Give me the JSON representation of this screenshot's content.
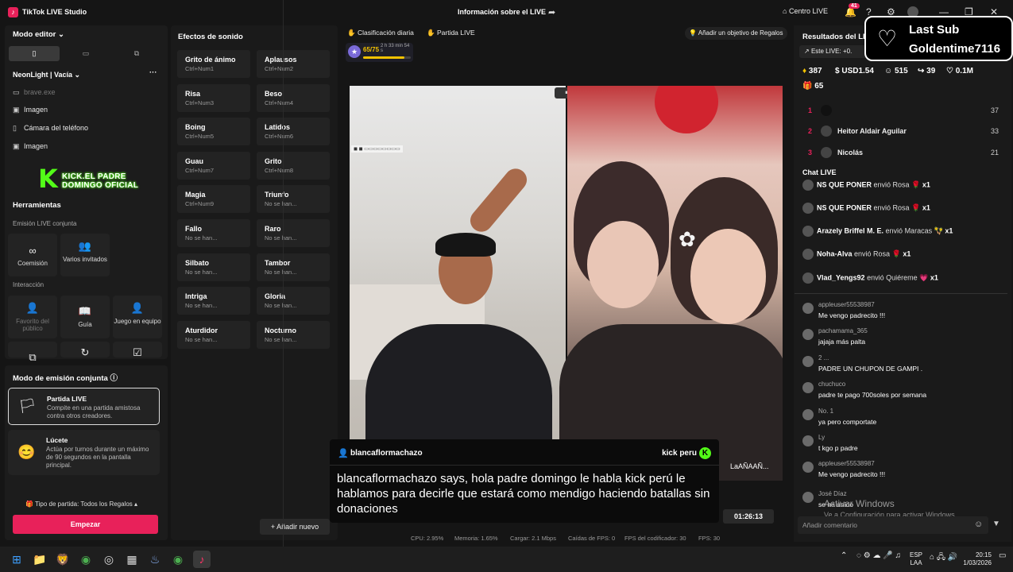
{
  "app": {
    "title": "TikTok LIVE Studio",
    "center_title": "Información sobre el LIVE",
    "home_label": "Centro LIVE",
    "notif_count": "41"
  },
  "left": {
    "editor_mode": "Modo editor",
    "scene_name": "NeonLight | Vacía",
    "sources": [
      {
        "label": "brave.exe",
        "icon": "window-icon"
      },
      {
        "label": "Imagen",
        "icon": "image-icon"
      },
      {
        "label": "Cámara del teléfono",
        "icon": "phone-icon"
      },
      {
        "label": "Imagen",
        "icon": "image-icon"
      }
    ],
    "kick_banner": "KICK.EL PADRE DOMINGO OFICIAL",
    "tools_title": "Herramientas",
    "joint_emit": "Emisión LIVE conjunta",
    "coemission": "Coemisión",
    "multi_guests": "Varios invitados",
    "interaction": "Interacción",
    "fav_public": "Favorito del público",
    "guide": "Guía",
    "team_game": "Juego en equipo"
  },
  "joint": {
    "title": "Modo de emisión conjunta",
    "cards": [
      {
        "title": "Partida LIVE",
        "desc": "Compite en una partida amistosa contra otros creadores."
      },
      {
        "title": "Lúcete",
        "desc": "Actúa por turnos durante un máximo de 90 segundos en la pantalla principal."
      }
    ],
    "match_type": "Tipo de partida: Todos los Regalos",
    "start": "Empezar"
  },
  "sounds": {
    "title": "Efectos de sonido",
    "items": [
      {
        "name": "Grito de ánimo",
        "key": "Ctrl+Num1"
      },
      {
        "name": "Aplausos",
        "key": "Ctrl+Num2"
      },
      {
        "name": "Risa",
        "key": "Ctrl+Num3"
      },
      {
        "name": "Beso",
        "key": "Ctrl+Num4"
      },
      {
        "name": "Boing",
        "key": "Ctrl+Num5"
      },
      {
        "name": "Latidos",
        "key": "Ctrl+Num6"
      },
      {
        "name": "Guau",
        "key": "Ctrl+Num7"
      },
      {
        "name": "Grito",
        "key": "Ctrl+Num8"
      },
      {
        "name": "Magia",
        "key": "Ctrl+Num9"
      },
      {
        "name": "Triunfo",
        "key": "No se han..."
      },
      {
        "name": "Fallo",
        "key": "No se han..."
      },
      {
        "name": "Raro",
        "key": "No se han..."
      },
      {
        "name": "Silbato",
        "key": "No se han..."
      },
      {
        "name": "Tambor",
        "key": "No se han..."
      },
      {
        "name": "Intriga",
        "key": "No se han..."
      },
      {
        "name": "Gloria",
        "key": "No se han..."
      },
      {
        "name": "Aturdidor",
        "key": "No se han..."
      },
      {
        "name": "Nocturno",
        "key": "No se han..."
      }
    ],
    "add": "Añadir nuevo"
  },
  "center": {
    "daily_rank": "Clasificación diaria",
    "live_match": "Partida LIVE",
    "gift_goal": "Añadir un objetivo de Regalos",
    "progress": "65/75",
    "progress_time": "2 h 33 min 54 s",
    "progress_fraction": 0.87,
    "right_video_label": "LaAÑAAÑ...",
    "caption_user": "blancaflormachazo",
    "caption_source": "kick peru",
    "caption_text": "blancaflormachazo says, hola padre domingo le habla kick perú le hablamos para decirle que estará como mendigo haciendo batallas sin donaciones",
    "timer": "01:26:13",
    "stats": [
      "CPU: 2.95%",
      "Memoria: 1.65%",
      "Cargar: 2.1 Mbps",
      "Caídas de FPS: 0",
      "FPS del codificador: 30",
      "FPS: 30"
    ]
  },
  "right": {
    "results_title": "Resultados del LI",
    "this_live": "Este LIVE: +0.",
    "last_sub_title": "Last Sub",
    "last_sub_name": "Goldentime7116",
    "metrics": [
      "387",
      "USD1.54",
      "515",
      "39",
      "0.1M"
    ],
    "metric2": "65",
    "ranking": [
      {
        "rank": "1",
        "name": "",
        "score": "37"
      },
      {
        "rank": "2",
        "name": "Heitor Aldair Aguilar",
        "score": "33"
      },
      {
        "rank": "3",
        "name": "Nicolás",
        "score": "21"
      }
    ],
    "chat_title": "Chat LIVE",
    "gifts": [
      {
        "user": "NS QUE PONER",
        "verb": "envió Rosa",
        "qty": "x1"
      },
      {
        "user": "NS QUE PONER",
        "verb": "envió Rosa",
        "qty": "x1"
      },
      {
        "user": "Arazely Briffel M. E.",
        "verb": "envió Maracas",
        "qty": "x1"
      },
      {
        "user": "Noha-Alva",
        "verb": "envió Rosa",
        "qty": "x1"
      },
      {
        "user": "Vlad_Yengs92",
        "verb": "envió Quiéreme",
        "qty": "x1"
      }
    ],
    "messages": [
      {
        "user": "appleuser55538987",
        "text": "Me vengo padrecito !!!"
      },
      {
        "user": "pachamama_365",
        "text": "jajaja más palta"
      },
      {
        "user": "2 ...",
        "text": "PADRE UN CHUPON DE GAMPI ."
      },
      {
        "user": "chuchuco",
        "text": "padre te pago 700soles por semana"
      },
      {
        "user": "No. 1",
        "text": "ya pero comportate"
      },
      {
        "user": "Ly",
        "text": "t kgo p padre"
      },
      {
        "user": "appleuser55538987",
        "text": "Me vengo padrecito !!!"
      },
      {
        "user": "José Díaz",
        "text": "se ha unido"
      }
    ],
    "chat_placeholder": "Añadir comentario",
    "activate1": "Activar Windows",
    "activate2": "Ve a Configuración para activar Windows."
  },
  "taskbar": {
    "lang1": "ESP",
    "lang2": "LAA",
    "time": "20:15",
    "date": "1/03/2026"
  }
}
